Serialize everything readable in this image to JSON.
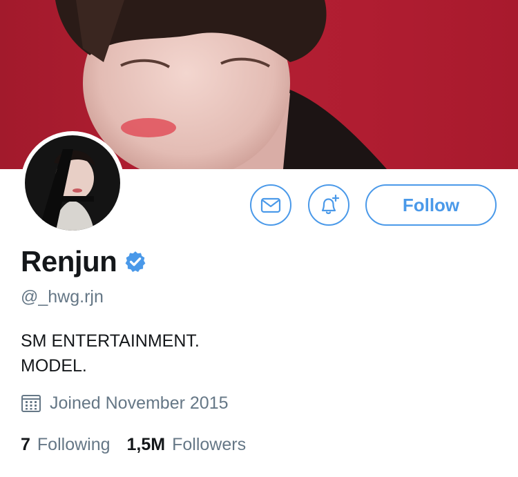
{
  "profile": {
    "name": "Renjun",
    "handle": "@_hwg.rjn",
    "verified": true,
    "bio_lines": [
      "SM ENTERTAINMENT.",
      "MODEL."
    ],
    "joined": "Joined November 2015"
  },
  "actions": {
    "message_icon": "envelope-icon",
    "notify_icon": "bell-plus-icon",
    "follow_label": "Follow"
  },
  "stats": {
    "following_count": "7",
    "following_label": "Following",
    "followers_count": "1,5M",
    "followers_label": "Followers"
  },
  "colors": {
    "accent": "#4a99e9",
    "banner": "#b01d31",
    "secondary_text": "#657786"
  }
}
